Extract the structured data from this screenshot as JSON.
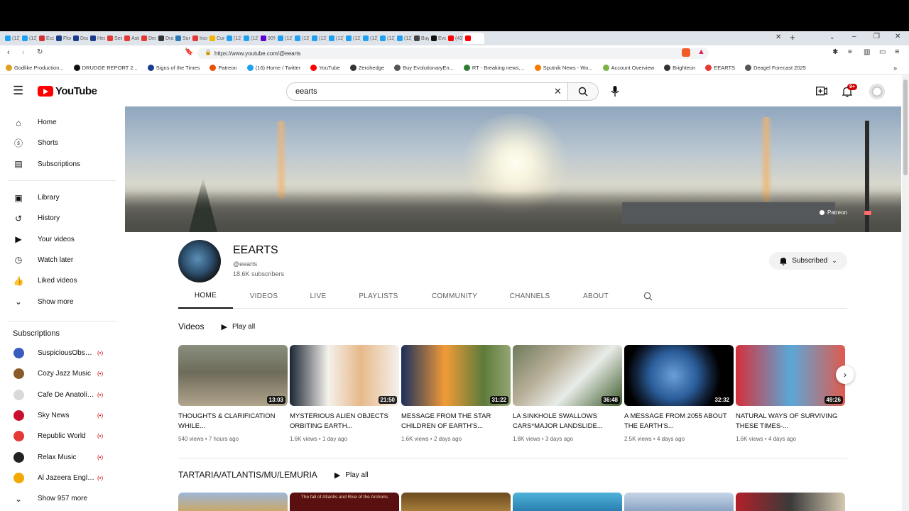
{
  "browser": {
    "tabs_visible": [
      "(12)",
      "(12)",
      "Eco",
      "Floo",
      "Doz",
      "Heav",
      "Sew",
      "Astr",
      "Deva",
      "Drain",
      "Surp",
      "Incre",
      "Curr",
      "(12)",
      "(12)",
      "90%",
      "(12)",
      "(12)",
      "(12)",
      "(12)",
      "(12)",
      "(12)",
      "(12)",
      "(12)",
      "Buy",
      "Evol",
      "(43)"
    ],
    "url": "https://www.youtube.com/@eearts",
    "bookmarks": [
      "Godlike Production...",
      "DRUDGE REPORT 2...",
      "Signs of the Times",
      "Patreon",
      "(16) Home / Twitter",
      "YouTube",
      "Zerohedge",
      "Buy EvolutionaryEn...",
      "RT - Breaking news,...",
      "Sputnik News - Wo...",
      "Account Overview",
      "Brighteon",
      "EEARTS",
      "Deagel Forecast 2025"
    ]
  },
  "masthead": {
    "logo_text": "YouTube",
    "search_value": "eearts",
    "notification_badge": "9+"
  },
  "sidebar": {
    "main": [
      {
        "label": "Home",
        "icon": "home-icon"
      },
      {
        "label": "Shorts",
        "icon": "shorts-icon"
      },
      {
        "label": "Subscriptions",
        "icon": "subscriptions-icon"
      }
    ],
    "you": [
      {
        "label": "Library",
        "icon": "library-icon"
      },
      {
        "label": "History",
        "icon": "history-icon"
      },
      {
        "label": "Your videos",
        "icon": "your-videos-icon"
      },
      {
        "label": "Watch later",
        "icon": "watch-later-icon"
      },
      {
        "label": "Liked videos",
        "icon": "liked-videos-icon"
      },
      {
        "label": "Show more",
        "icon": "chevron-down-icon"
      }
    ],
    "subscriptions_heading": "Subscriptions",
    "subscriptions": [
      {
        "label": "SuspiciousObser...",
        "color": "#3a5bbf"
      },
      {
        "label": "Cozy Jazz Music",
        "color": "#8a5a2b"
      },
      {
        "label": "Cafe De Anatolia...",
        "color": "#d9d9d9"
      },
      {
        "label": "Sky News",
        "color": "#c8102e"
      },
      {
        "label": "Republic World",
        "color": "#e53935"
      },
      {
        "label": "Relax Music",
        "color": "#222222"
      },
      {
        "label": "Al Jazeera English",
        "color": "#f2a900"
      }
    ],
    "show_more_subs": "Show 957 more"
  },
  "banner": {
    "link_label": "Patreon"
  },
  "channel": {
    "name": "EEARTS",
    "handle": "@eearts",
    "subscribers": "18.6K subscribers",
    "subscribe_label": "Subscribed",
    "tabs": [
      "HOME",
      "VIDEOS",
      "LIVE",
      "PLAYLISTS",
      "COMMUNITY",
      "CHANNELS",
      "ABOUT"
    ]
  },
  "shelf1": {
    "title": "Videos",
    "play_all": "Play all",
    "videos": [
      {
        "title": "THOUGHTS & CLARIFICATION WHILE...",
        "duration": "13:03",
        "views": "540 views",
        "age": "7 hours ago"
      },
      {
        "title": "MYSTERIOUS ALIEN OBJECTS ORBITING EARTH...",
        "duration": "21:50",
        "views": "1.6K views",
        "age": "1 day ago"
      },
      {
        "title": "MESSAGE FROM THE STAR CHILDREN OF EARTH'S...",
        "duration": "31:22",
        "views": "1.6K views",
        "age": "2 days ago"
      },
      {
        "title": "LA SINKHOLE SWALLOWS CARS*MAJOR LANDSLIDE...",
        "duration": "36:48",
        "views": "1.8K views",
        "age": "3 days ago"
      },
      {
        "title": "A MESSAGE FROM 2055 ABOUT THE EARTH'S...",
        "duration": "32:32",
        "views": "2.5K views",
        "age": "4 days ago"
      },
      {
        "title": "NATURAL WAYS OF SURVIVING THESE TIMES-...",
        "duration": "49:26",
        "views": "1.6K views",
        "age": "4 days ago"
      }
    ]
  },
  "shelf2": {
    "title": "TARTARIA/ATLANTIS/MU/LEMURIA",
    "play_all": "Play all",
    "partial_thumb_text": "The fall of Atlantis and Rise of the Archons"
  }
}
